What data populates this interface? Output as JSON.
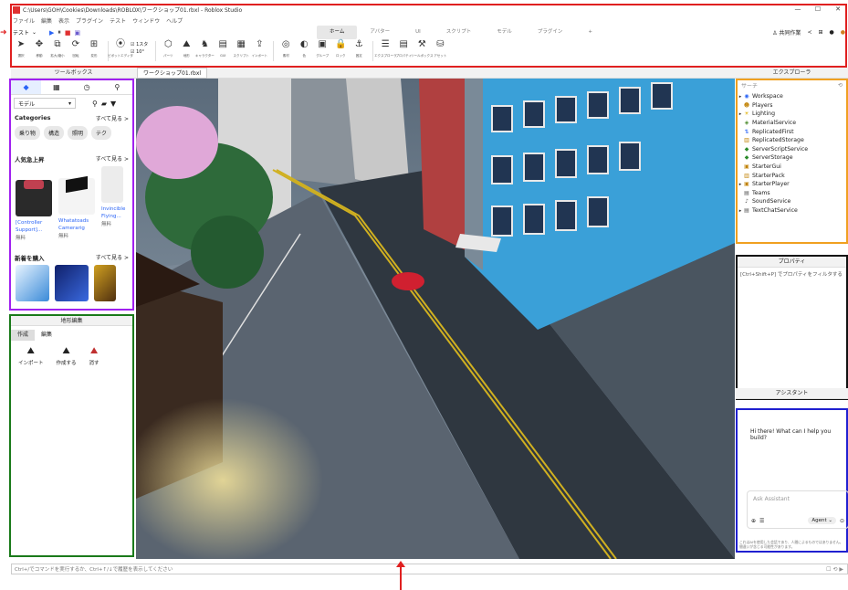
{
  "window": {
    "title": "C:\\Users\\GOH\\Cookies\\Downloads\\ROBLOX\\ワークショップ01.rbxl - Roblox Studio",
    "controls": [
      "—",
      "☐",
      "✕"
    ]
  },
  "menu": {
    "items": [
      "ファイル",
      "編集",
      "表示",
      "プラグイン",
      "テスト",
      "ウィンドウ",
      "ヘルプ"
    ]
  },
  "toolbar": {
    "test_mode": "テスト",
    "tabs": [
      "ホーム",
      "アバター",
      "UI",
      "スクリプト",
      "モデル",
      "プラグイン",
      "+"
    ],
    "share_label": "共同作業",
    "ribbon": [
      {
        "icon": "select-icon",
        "glyph": "➤",
        "label": "選択"
      },
      {
        "icon": "move-icon",
        "glyph": "✥",
        "label": "移動"
      },
      {
        "icon": "scale-icon",
        "glyph": "⧉",
        "label": "拡大/縮小"
      },
      {
        "icon": "rotate-icon",
        "glyph": "⟳",
        "label": "回転"
      },
      {
        "icon": "transform-icon",
        "glyph": "⊞",
        "label": "変形"
      },
      {
        "icon": "pivot-icon",
        "glyph": "⦿",
        "label": "ピボットエディタ"
      },
      {
        "icon": "part-icon",
        "glyph": "⬡",
        "label": "パーツ"
      },
      {
        "icon": "terrain-icon",
        "glyph": "⛰",
        "label": "地形"
      },
      {
        "icon": "character-icon",
        "glyph": "♞",
        "label": "キャラクター"
      },
      {
        "icon": "gui-icon",
        "glyph": "▤",
        "label": "GUI"
      },
      {
        "icon": "script-icon",
        "glyph": "▦",
        "label": "スクリプト"
      },
      {
        "icon": "import-icon",
        "glyph": "⇪",
        "label": "インポート"
      },
      {
        "icon": "material-icon",
        "glyph": "◎",
        "label": "素材"
      },
      {
        "icon": "color-icon",
        "glyph": "◐",
        "label": "色"
      },
      {
        "icon": "group-icon",
        "glyph": "▣",
        "label": "グループ"
      },
      {
        "icon": "lock-icon",
        "glyph": "🔒",
        "label": "ロック"
      },
      {
        "icon": "anchor-icon",
        "glyph": "⚓",
        "label": "固定"
      },
      {
        "icon": "explorer-icon",
        "glyph": "☰",
        "label": "エクスプローラ"
      },
      {
        "icon": "properties-icon",
        "glyph": "▤",
        "label": "プロパティ"
      },
      {
        "icon": "toolbox-icon",
        "glyph": "⚒",
        "label": "ツールボックス"
      },
      {
        "icon": "asset-icon",
        "glyph": "⛁",
        "label": "アセット"
      }
    ],
    "snap_move": "1スタ",
    "snap_rotate": "10°"
  },
  "toolbox": {
    "title": "ツールボックス",
    "category_select": "モデル",
    "categories_heading": "Categories",
    "see_all": "すべて見る >",
    "category_pills": [
      "乗り物",
      "構造",
      "照明",
      "テク"
    ],
    "trending_heading": "人気急上昇",
    "trending": [
      {
        "name": "[Controller Support]...",
        "price": "無料"
      },
      {
        "name": "Whatatoads Camerarig",
        "price": "無料"
      },
      {
        "name": "Invincible Flying...",
        "price": "無料"
      }
    ],
    "new_heading": "新着を購入"
  },
  "terrain": {
    "title": "地形編集",
    "tabs": [
      "作成",
      "編集"
    ],
    "tools": [
      {
        "icon": "import-icon",
        "label": "インポート"
      },
      {
        "icon": "generate-icon",
        "label": "作成する"
      },
      {
        "icon": "clear-icon",
        "label": "消す"
      }
    ]
  },
  "viewport": {
    "tab": "ワークショップ01.rbxl"
  },
  "explorer": {
    "title": "エクスプローラ",
    "search_placeholder": "サーチ",
    "items": [
      {
        "name": "Workspace",
        "icon": "globe-icon",
        "glyph": "◉",
        "color": "#2a64f6",
        "expand": "▸"
      },
      {
        "name": "Players",
        "icon": "players-icon",
        "glyph": "☻",
        "color": "#c08000",
        "expand": ""
      },
      {
        "name": "Lighting",
        "icon": "lighting-icon",
        "glyph": "☀",
        "color": "#e0b000",
        "expand": "▸"
      },
      {
        "name": "MaterialService",
        "icon": "material-service-icon",
        "glyph": "◈",
        "color": "#4a8a2a",
        "expand": ""
      },
      {
        "name": "ReplicatedFirst",
        "icon": "replicated-first-icon",
        "glyph": "⇅",
        "color": "#2a64f6",
        "expand": ""
      },
      {
        "name": "ReplicatedStorage",
        "icon": "replicated-storage-icon",
        "glyph": "▥",
        "color": "#c08000",
        "expand": ""
      },
      {
        "name": "ServerScriptService",
        "icon": "server-script-icon",
        "glyph": "◆",
        "color": "#2a8a2a",
        "expand": ""
      },
      {
        "name": "ServerStorage",
        "icon": "server-storage-icon",
        "glyph": "◆",
        "color": "#2a8a2a",
        "expand": ""
      },
      {
        "name": "StarterGui",
        "icon": "starter-gui-icon",
        "glyph": "▣",
        "color": "#c08000",
        "expand": ""
      },
      {
        "name": "StarterPack",
        "icon": "starter-pack-icon",
        "glyph": "▥",
        "color": "#c08000",
        "expand": ""
      },
      {
        "name": "StarterPlayer",
        "icon": "starter-player-icon",
        "glyph": "▣",
        "color": "#c08000",
        "expand": "▸"
      },
      {
        "name": "Teams",
        "icon": "teams-icon",
        "glyph": "▤",
        "color": "#555555",
        "expand": ""
      },
      {
        "name": "SoundService",
        "icon": "sound-icon",
        "glyph": "♪",
        "color": "#555555",
        "expand": ""
      },
      {
        "name": "TextChatService",
        "icon": "chat-icon",
        "glyph": "▤",
        "color": "#555555",
        "expand": "▸"
      }
    ]
  },
  "properties": {
    "title": "プロパティ",
    "message": "[Ctrl+Shift+P] でプロパティをフィルタする"
  },
  "assistant": {
    "title": "アシスタント",
    "greeting": "Hi there! What can I help you build?",
    "input_placeholder": "Ask Assistant",
    "mode": "Agent",
    "disclaimer": "これはAIを使用した会話であり、人間によるものではありません。間違いが含じる可能性があります。"
  },
  "command_bar": {
    "placeholder": "Ctrl+/でコマンドを実行するか、Ctrl+↑/↓で履歴を表示してください"
  }
}
